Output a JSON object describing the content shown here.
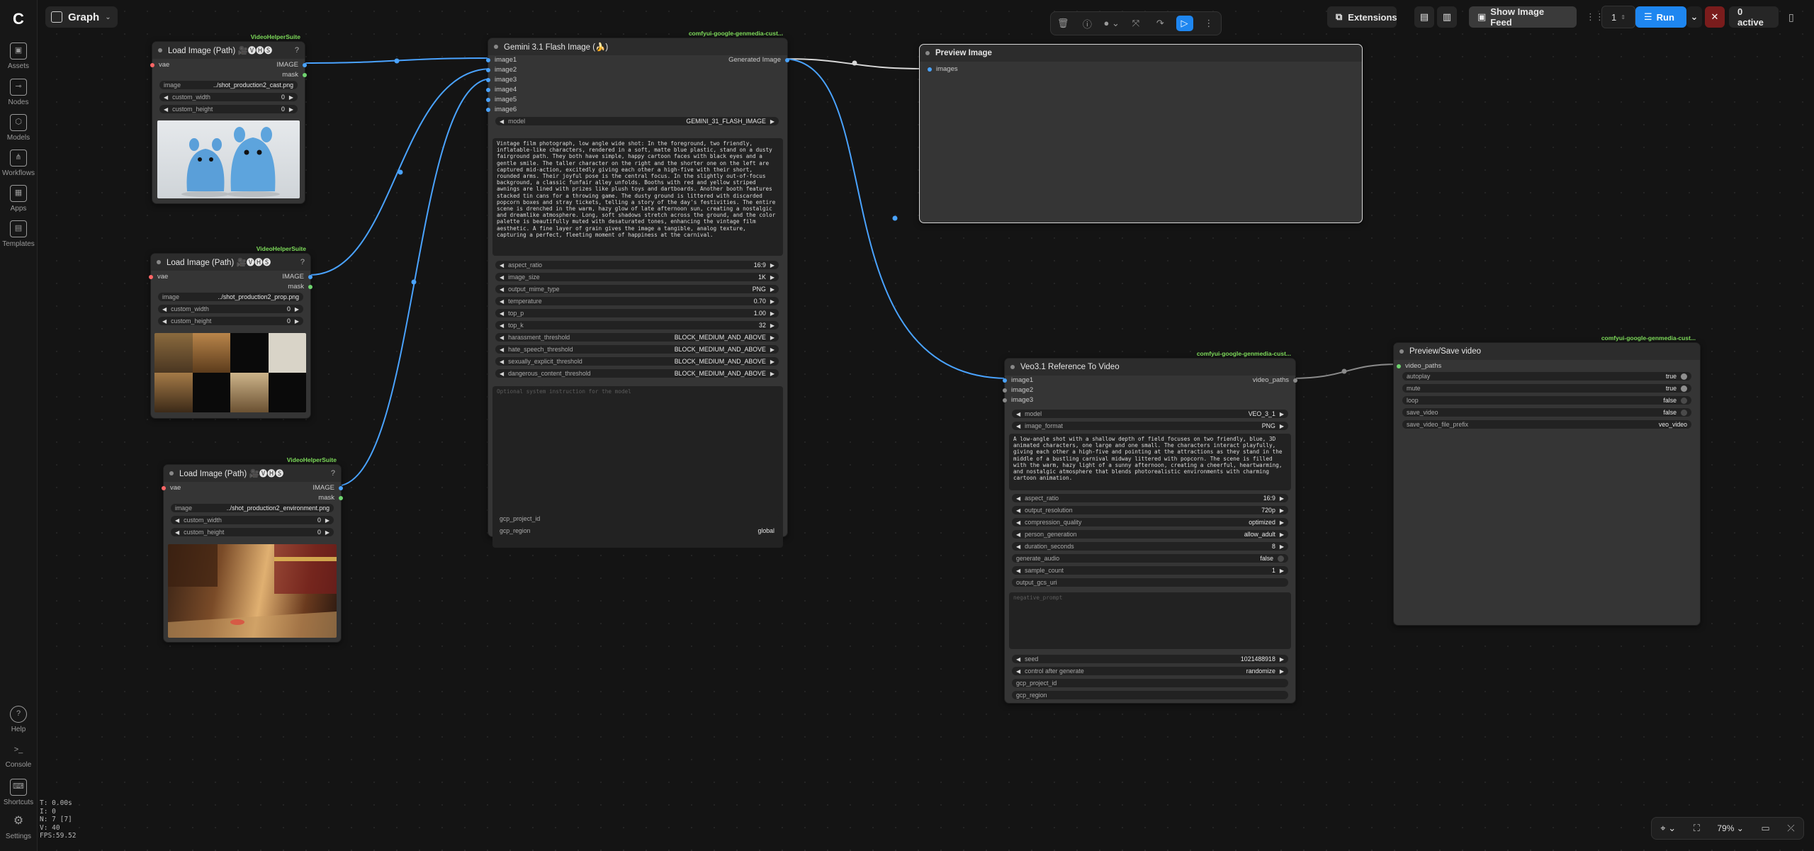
{
  "topbar": {
    "graph_label": "Graph",
    "extensions_label": "Extensions",
    "image_feed_label": "Show Image Feed",
    "queue_count": "1",
    "run_label": "Run",
    "active_label": "0 active"
  },
  "sidebar": {
    "items": [
      {
        "label": "Assets",
        "icon": "assets-icon"
      },
      {
        "label": "Nodes",
        "icon": "nodes-icon"
      },
      {
        "label": "Models",
        "icon": "models-icon"
      },
      {
        "label": "Workflows",
        "icon": "workflows-icon"
      },
      {
        "label": "Apps",
        "icon": "apps-icon"
      },
      {
        "label": "Templates",
        "icon": "templates-icon"
      }
    ],
    "bottom": [
      {
        "label": "Help"
      },
      {
        "label": "Console"
      },
      {
        "label": "Shortcuts"
      },
      {
        "label": "Settings"
      }
    ]
  },
  "stats": {
    "t": "T: 0.00s",
    "i": "I: 0",
    "n": "N: 7 [7]",
    "v": "V: 40",
    "fps": "FPS:59.52"
  },
  "zoom": {
    "value": "79%"
  },
  "load1": {
    "badge": "VideoHelperSuite",
    "title": "Load Image (Path) 🎥🅥🅗🅢",
    "in_vae": "vae",
    "out_image": "IMAGE",
    "out_mask": "mask",
    "image_label": "image",
    "image_value": "../shot_production2_cast.png",
    "w_label": "custom_width",
    "w_value": "0",
    "h_label": "custom_height",
    "h_value": "0"
  },
  "load2": {
    "badge": "VideoHelperSuite",
    "title": "Load Image (Path) 🎥🅥🅗🅢",
    "in_vae": "vae",
    "out_image": "IMAGE",
    "out_mask": "mask",
    "image_label": "image",
    "image_value": "../shot_production2_prop.png",
    "w_label": "custom_width",
    "w_value": "0",
    "h_label": "custom_height",
    "h_value": "0"
  },
  "load3": {
    "badge": "VideoHelperSuite",
    "title": "Load Image (Path) 🎥🅥🅗🅢",
    "in_vae": "vae",
    "out_image": "IMAGE",
    "out_mask": "mask",
    "image_label": "image",
    "image_value": "../shot_production2_environment.png",
    "w_label": "custom_width",
    "w_value": "0",
    "h_label": "custom_height",
    "h_value": "0"
  },
  "gemini": {
    "badge": "comfyui-google-genmedia-cust...",
    "title": "Gemini 3.1 Flash Image (🍌)",
    "inputs": [
      "image1",
      "image2",
      "image3",
      "image4",
      "image5",
      "image6"
    ],
    "output": "Generated Image",
    "model_label": "model",
    "model_value": "GEMINI_31_FLASH_IMAGE",
    "prompt": "Vintage film photograph, low angle wide shot: In the foreground, two friendly, inflatable-like characters, rendered in a soft, matte blue plastic, stand on a dusty fairground path. They both have simple, happy cartoon faces with black eyes and a gentle smile. The taller character on the right and the shorter one on the left are captured mid-action, excitedly giving each other a high-five with their short, rounded arms. Their joyful pose is the central focus. In the slightly out-of-focus background, a classic funfair alley unfolds. Booths with red and yellow striped awnings are lined with prizes like plush toys and dartboards. Another booth features stacked tin cans for a throwing game. The dusty ground is littered with discarded popcorn boxes and stray tickets, telling a story of the day's festivities. The entire scene is drenched in the warm, hazy glow of late afternoon sun, creating a nostalgic and dreamlike atmosphere. Long, soft shadows stretch across the ground, and the color palette is beautifully muted with desaturated tones, enhancing the vintage film aesthetic. A fine layer of grain gives the image a tangible, analog texture, capturing a perfect, fleeting moment of happiness at the carnival.",
    "params": [
      {
        "label": "aspect_ratio",
        "value": "16:9"
      },
      {
        "label": "image_size",
        "value": "1K"
      },
      {
        "label": "output_mime_type",
        "value": "PNG"
      },
      {
        "label": "temperature",
        "value": "0.70"
      },
      {
        "label": "top_p",
        "value": "1.00"
      },
      {
        "label": "top_k",
        "value": "32"
      },
      {
        "label": "harassment_threshold",
        "value": "BLOCK_MEDIUM_AND_ABOVE"
      },
      {
        "label": "hate_speech_threshold",
        "value": "BLOCK_MEDIUM_AND_ABOVE"
      },
      {
        "label": "sexually_explicit_threshold",
        "value": "BLOCK_MEDIUM_AND_ABOVE"
      },
      {
        "label": "dangerous_content_threshold",
        "value": "BLOCK_MEDIUM_AND_ABOVE"
      }
    ],
    "system_placeholder": "Optional system instruction for the model",
    "project_label": "gcp_project_id",
    "region_label": "gcp_region",
    "region_value": "global"
  },
  "preview": {
    "title": "Preview Image",
    "input": "images"
  },
  "veo": {
    "badge": "comfyui-google-genmedia-cust...",
    "title": "Veo3.1 Reference To Video",
    "inputs": [
      "image1",
      "image2",
      "image3"
    ],
    "output": "video_paths",
    "model_label": "model",
    "model_value": "VEO_3_1",
    "format_label": "image_format",
    "format_value": "PNG",
    "prompt": "A low-angle shot with a shallow depth of field focuses on two friendly, blue, 3D animated characters, one large and one small. The characters interact playfully, giving each other a high-five and pointing at the attractions as they stand in the middle of a bustling carnival midway littered with popcorn. The scene is filled with the warm, hazy light of a sunny afternoon, creating a cheerful, heartwarming, and nostalgic atmosphere that blends photorealistic environments with charming cartoon animation.",
    "params": [
      {
        "label": "aspect_ratio",
        "value": "16:9"
      },
      {
        "label": "output_resolution",
        "value": "720p"
      },
      {
        "label": "compression_quality",
        "value": "optimized"
      },
      {
        "label": "person_generation",
        "value": "allow_adult"
      },
      {
        "label": "duration_seconds",
        "value": "8"
      }
    ],
    "generate_audio_label": "generate_audio",
    "generate_audio_value": "false",
    "sample_count_label": "sample_count",
    "sample_count_value": "1",
    "gcs_label": "output_gcs_uri",
    "negative_placeholder": "negative_prompt",
    "seed_label": "seed",
    "seed_value": "1021488918",
    "control_label": "control after generate",
    "control_value": "randomize",
    "project_label": "gcp_project_id",
    "region_label": "gcp_region"
  },
  "save": {
    "badge": "comfyui-google-genmedia-cust...",
    "title": "Preview/Save video",
    "input": "video_paths",
    "toggles": [
      {
        "label": "autoplay",
        "value": "true",
        "on": true
      },
      {
        "label": "mute",
        "value": "true",
        "on": true
      },
      {
        "label": "loop",
        "value": "false",
        "on": false
      },
      {
        "label": "save_video",
        "value": "false",
        "on": false
      }
    ],
    "prefix_label": "save_video_file_prefix",
    "prefix_value": "veo_video"
  }
}
